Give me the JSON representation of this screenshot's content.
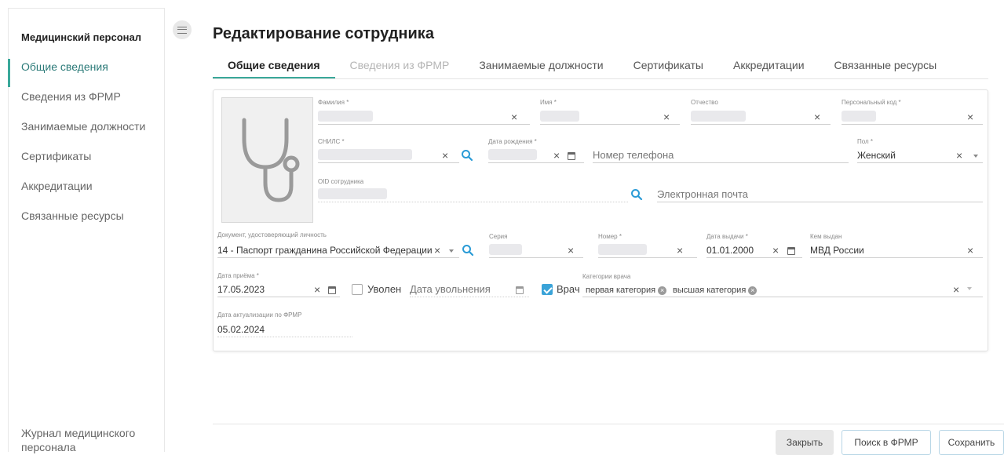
{
  "sidebar": {
    "title": "Медицинский персонал",
    "items": [
      {
        "label": "Общие сведения"
      },
      {
        "label": "Сведения из ФРМР"
      },
      {
        "label": "Занимаемые должности"
      },
      {
        "label": "Сертификаты"
      },
      {
        "label": "Аккредитации"
      },
      {
        "label": "Связанные ресурсы"
      }
    ],
    "footer_link": "Журнал медицинского персонала"
  },
  "page": {
    "title": "Редактирование сотрудника"
  },
  "tabs": [
    {
      "label": "Общие сведения"
    },
    {
      "label": "Сведения из ФРМР"
    },
    {
      "label": "Занимаемые должности"
    },
    {
      "label": "Сертификаты"
    },
    {
      "label": "Аккредитации"
    },
    {
      "label": "Связанные ресурсы"
    }
  ],
  "form": {
    "surname": {
      "label": "Фамилия *",
      "value": ""
    },
    "name": {
      "label": "Имя *",
      "value": ""
    },
    "patronymic": {
      "label": "Отчество",
      "value": ""
    },
    "personal_code": {
      "label": "Персональный код *",
      "value": ""
    },
    "snils": {
      "label": "СНИЛС *",
      "value": ""
    },
    "birth_date": {
      "label": "Дата рождения *",
      "value": ""
    },
    "phone": {
      "placeholder": "Номер телефона"
    },
    "gender": {
      "label": "Пол *",
      "value": "Женский"
    },
    "oid": {
      "label": "OID сотрудника",
      "value": ""
    },
    "email": {
      "placeholder": "Электронная почта"
    },
    "id_document": {
      "label": "Документ, удостоверяющий личность",
      "value": "14 - Паспорт гражданина Российской Федерации"
    },
    "series": {
      "label": "Серия",
      "value": ""
    },
    "number": {
      "label": "Номер *",
      "value": ""
    },
    "issue_date": {
      "label": "Дата выдачи *",
      "value": "01.01.2000"
    },
    "issued_by": {
      "label": "Кем выдан",
      "value": "МВД России"
    },
    "hire_date": {
      "label": "Дата приёма *",
      "value": "17.05.2023"
    },
    "dismissed": {
      "label": "Уволен",
      "checked": false
    },
    "dismissal_date": {
      "placeholder": "Дата увольнения"
    },
    "doctor": {
      "label": "Врач",
      "checked": true
    },
    "doctor_categories": {
      "label": "Категории врача",
      "chips": [
        "первая категория",
        "высшая категория"
      ]
    },
    "frmr_update_date": {
      "label": "Дата актуализации по ФРМР",
      "value": "05.02.2024"
    }
  },
  "buttons": {
    "close": "Закрыть",
    "frmr_search": "Поиск в ФРМР",
    "save": "Сохранить"
  },
  "colors": {
    "accent": "#3aa89a",
    "checkbox": "#3aa3d8",
    "search_icon": "#2a9bd6"
  },
  "icons": [
    "menu-icon",
    "stethoscope-icon",
    "clear-icon",
    "search-icon",
    "calendar-icon",
    "dropdown-arrow-icon",
    "chip-remove-icon"
  ]
}
